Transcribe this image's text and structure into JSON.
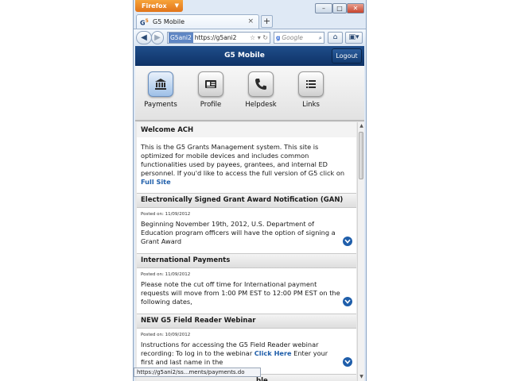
{
  "browser": {
    "menu_label": "Firefox",
    "tab_title": "G5 Mobile",
    "favicon_text": "G",
    "favicon_sup": "5",
    "url_identity": "G5ani2",
    "url_text": "https://g5ani2",
    "search_engine_glyph": "g",
    "search_placeholder": "Google",
    "status_text": "https://g5ani2/ss...ments/payments.do"
  },
  "app": {
    "title": "G5 Mobile",
    "logout_label": "Logout",
    "nav": [
      {
        "label": "Payments",
        "icon": "bank-icon",
        "active": true
      },
      {
        "label": "Profile",
        "icon": "id-card-icon",
        "active": false
      },
      {
        "label": "Helpdesk",
        "icon": "phone-icon",
        "active": false
      },
      {
        "label": "Links",
        "icon": "list-icon",
        "active": false
      }
    ]
  },
  "welcome": {
    "title": "Welcome ACH",
    "body": "This is the G5 Grants Management system. This site is optimized for mobile devices and includes common functionalities used by payees, grantees, and internal ED personnel. If you'd like to access the full version of G5 click on ",
    "link": "Full Site"
  },
  "news": [
    {
      "title": "Electronically Signed Grant Award Notification (GAN)",
      "posted": "Posted on: 11/09/2012",
      "body": "Beginning November 19th, 2012, U.S. Department of Education program officers will have the option of signing a Grant Award"
    },
    {
      "title": "International Payments",
      "posted": "Posted on: 11/09/2012",
      "body": "Please note the cut off time for International payment requests will move from 1:00 PM EST to 12:00 PM EST on the following dates,"
    },
    {
      "title": "NEW G5 Field Reader Webinar",
      "posted": "Posted on: 10/09/2012",
      "body_before": "Instructions for accessing the G5 Field Reader webinar recording: To log in to the webinar ",
      "link": "Click Here",
      "body_after": " Enter your first and last name in the"
    },
    {
      "title_visible_fragment": "ble"
    }
  ],
  "colors": {
    "header_blue": "#0e3266",
    "link_blue": "#1f5eaa",
    "firefox_orange": "#e1741a"
  }
}
